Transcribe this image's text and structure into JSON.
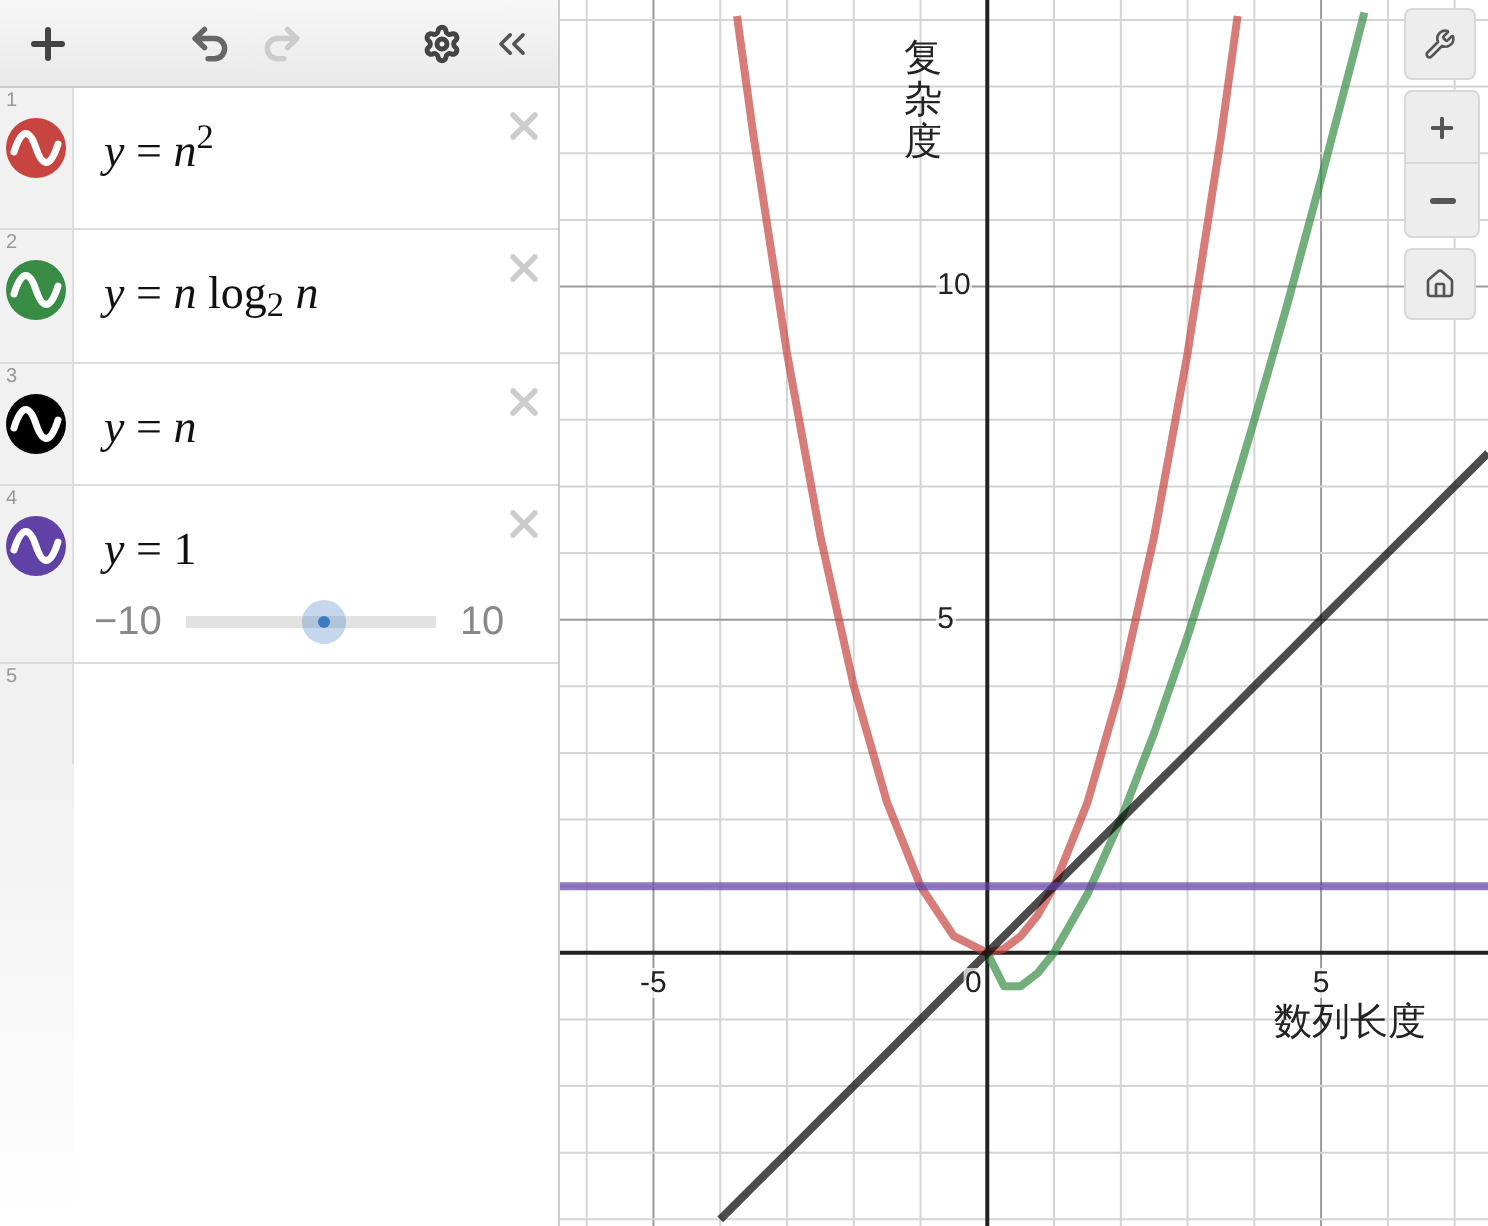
{
  "toolbar": {
    "redo": {
      "disabled": true
    }
  },
  "expressions": [
    {
      "number": "1",
      "color": "#c74440",
      "latex": "*y* = *n*$^{2}$"
    },
    {
      "number": "2",
      "color": "#388c46",
      "latex": "*y* = *n* log$_{2}$ *n*"
    },
    {
      "number": "3",
      "color": "#000000",
      "latex": "*y* = *n*"
    },
    {
      "number": "4",
      "color": "#6042a6",
      "latex": "*y* = 1",
      "slider": {
        "min": "−10",
        "max": "10",
        "level": 0.55
      }
    },
    {
      "number": "5"
    }
  ],
  "graph": {
    "chart_data": {
      "type": "line",
      "grid": true,
      "xlabel": "数列长度",
      "ylabel": "复杂度",
      "xlim": [
        -6.4,
        7.5
      ],
      "ylim": [
        -4.1,
        14.3
      ],
      "xticks": [
        {
          "value": -5,
          "label": "-5"
        },
        0,
        5
      ],
      "yticks": [
        5,
        10
      ],
      "x": [
        -6.4,
        -6,
        -5.5,
        -5,
        -4.5,
        -4,
        -3.75,
        -3.5,
        -3,
        -2.5,
        -2,
        -1.5,
        -1,
        -0.5,
        0,
        0.25,
        0.5,
        0.75,
        1,
        1.5,
        2,
        2.5,
        3,
        3.5,
        3.75,
        4,
        4.5,
        5,
        5.5,
        5.65,
        6,
        6.5,
        7,
        7.5
      ],
      "series": [
        {
          "color": "#c74440",
          "values": [
            null,
            null,
            null,
            null,
            null,
            null,
            14.06,
            12.25,
            9,
            6.25,
            4,
            2.25,
            1,
            0.25,
            0,
            0.06,
            0.25,
            0.56,
            1,
            2.25,
            4,
            6.25,
            9,
            12.25,
            14.06,
            null,
            null,
            null,
            null,
            null,
            null,
            null,
            null,
            null
          ]
        },
        {
          "color": "#388c46",
          "values": [
            null,
            null,
            null,
            null,
            null,
            null,
            null,
            null,
            null,
            null,
            null,
            null,
            null,
            null,
            0,
            -0.5,
            -0.5,
            -0.31,
            0,
            0.88,
            2,
            3.3,
            4.75,
            6.33,
            7.15,
            8,
            9.76,
            11.61,
            13.53,
            14.11,
            null,
            null,
            null,
            null
          ]
        },
        {
          "color": "#000000",
          "values": [
            null,
            null,
            null,
            null,
            null,
            -4,
            -3.75,
            -3.5,
            -3,
            -2.5,
            -2,
            -1.5,
            -1,
            -0.5,
            0,
            0.25,
            0.5,
            0.75,
            1,
            1.5,
            2,
            2.5,
            3,
            3.5,
            3.75,
            4,
            4.5,
            5,
            5.5,
            5.65,
            6,
            6.5,
            7,
            7.5
          ]
        },
        {
          "color": "#6042a6",
          "values": [
            1,
            1,
            1,
            1,
            1,
            1,
            1,
            1,
            1,
            1,
            1,
            1,
            1,
            1,
            1,
            1,
            1,
            1,
            1,
            1,
            1,
            1,
            1,
            1,
            1,
            1,
            1,
            1,
            1,
            1,
            1,
            1,
            1,
            1
          ]
        }
      ]
    }
  }
}
